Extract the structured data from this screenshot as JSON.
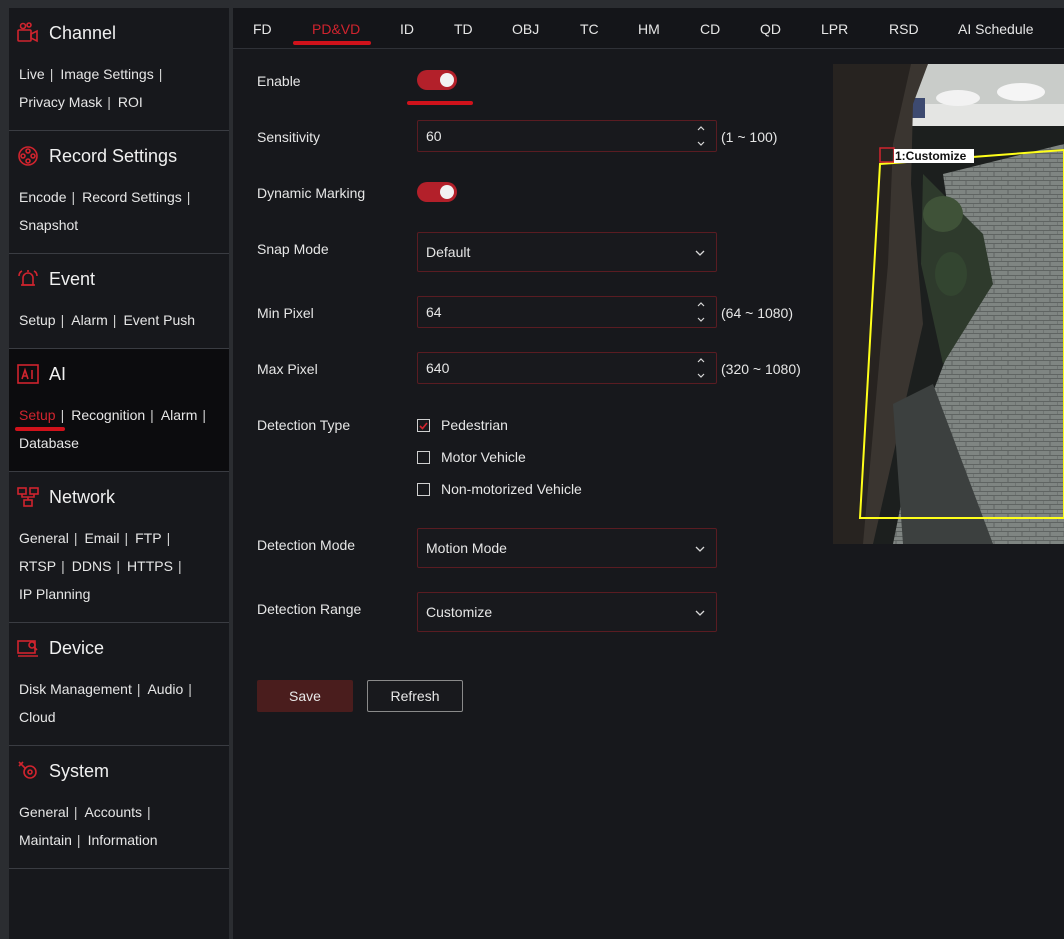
{
  "sidebar": {
    "sections": [
      {
        "title": "Channel",
        "icon": "camera-icon",
        "links": [
          "Live",
          "Image Settings",
          "Privacy Mask",
          "ROI"
        ]
      },
      {
        "title": "Record Settings",
        "icon": "film-reel-icon",
        "links": [
          "Encode",
          "Record Settings",
          "Snapshot"
        ]
      },
      {
        "title": "Event",
        "icon": "alarm-bell-icon",
        "links": [
          "Setup",
          "Alarm",
          "Event Push"
        ]
      },
      {
        "title": "AI",
        "icon": "ai-icon",
        "links": [
          "Setup",
          "Recognition",
          "Alarm",
          "Database"
        ]
      },
      {
        "title": "Network",
        "icon": "network-icon",
        "links": [
          "General",
          "Email",
          "FTP",
          "RTSP",
          "DDNS",
          "HTTPS",
          "IP Planning"
        ]
      },
      {
        "title": "Device",
        "icon": "device-icon",
        "links": [
          "Disk Management",
          "Audio",
          "Cloud"
        ]
      },
      {
        "title": "System",
        "icon": "system-gear-icon",
        "links": [
          "General",
          "Accounts",
          "Maintain",
          "Information"
        ]
      }
    ]
  },
  "tabs": [
    "FD",
    "PD&VD",
    "ID",
    "TD",
    "OBJ",
    "TC",
    "HM",
    "CD",
    "QD",
    "LPR",
    "RSD",
    "AI Schedule"
  ],
  "active_tab": "PD&VD",
  "form": {
    "enable_label": "Enable",
    "enable_on": true,
    "sensitivity_label": "Sensitivity",
    "sensitivity_value": "60",
    "sensitivity_range": "(1 ~ 100)",
    "dynamic_marking_label": "Dynamic Marking",
    "dynamic_marking_on": true,
    "snap_mode_label": "Snap Mode",
    "snap_mode_value": "Default",
    "min_pixel_label": "Min Pixel",
    "min_pixel_value": "64",
    "min_pixel_range": "(64 ~ 1080)",
    "max_pixel_label": "Max Pixel",
    "max_pixel_value": "640",
    "max_pixel_range": "(320 ~ 1080)",
    "detection_type_label": "Detection Type",
    "detection_types": [
      {
        "label": "Pedestrian",
        "checked": true
      },
      {
        "label": "Motor Vehicle",
        "checked": false
      },
      {
        "label": "Non-motorized Vehicle",
        "checked": false
      }
    ],
    "detection_mode_label": "Detection Mode",
    "detection_mode_value": "Motion Mode",
    "detection_range_label": "Detection Range",
    "detection_range_value": "Customize"
  },
  "buttons": {
    "save": "Save",
    "refresh": "Refresh"
  },
  "preview": {
    "region_label": "1:Customize"
  },
  "colors": {
    "accent": "#d0242e",
    "region": "#ffff1a"
  }
}
